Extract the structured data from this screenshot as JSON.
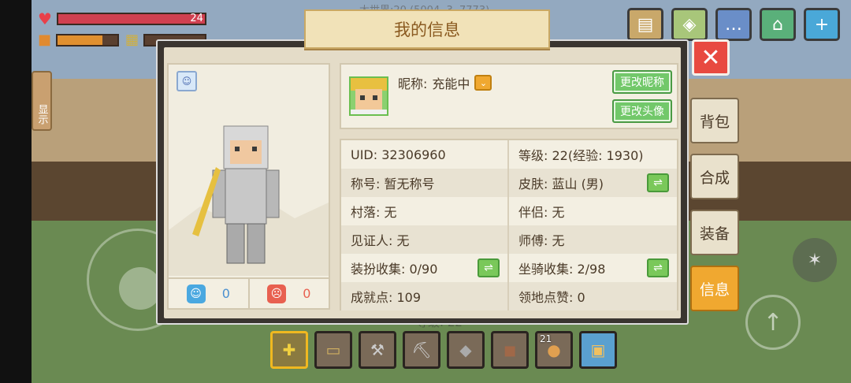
{
  "hud": {
    "health_value": "24",
    "health_fraction": 1.0,
    "hunger_fraction": 0.75,
    "xp_fraction": 0.0,
    "world_info": "大世界:20 (5004, 3, 7773)",
    "side_hint": "显示",
    "level_text": "等级: 22"
  },
  "top_buttons": [
    "book-icon",
    "map-icon",
    "chat-icon",
    "shop-icon",
    "plus-icon"
  ],
  "dialog": {
    "title": "我的信息",
    "close_glyph": "✕"
  },
  "profile": {
    "nickname_label": "昵称:",
    "nickname": "充能中",
    "rename_button": "更改昵称",
    "change_avatar_button": "更改头像",
    "likes": "0",
    "dislikes": "0"
  },
  "info": {
    "uid": "UID: 32306960",
    "level": "等级: 22(经验: 1930)",
    "title": "称号: 暂无称号",
    "skin": "皮肤: 蓝山 (男)",
    "village": "村落: 无",
    "partner": "伴侣: 无",
    "witness": "见证人: 无",
    "master": "师傅: 无",
    "outfit": "装扮收集: 0/90",
    "mount": "坐骑收集: 2/98",
    "achievement": "成就点: 109",
    "territory_likes": "领地点赞: 0"
  },
  "side_tabs": {
    "backpack": "背包",
    "craft": "合成",
    "equip": "装备",
    "info": "信息"
  },
  "hotbar": {
    "count_slot7": "21",
    "items": [
      "kite-icon",
      "scroll-icon",
      "axe-icon",
      "pickaxe-icon",
      "flint-icon",
      "leather-icon",
      "bread-icon",
      "backpack-icon"
    ]
  }
}
